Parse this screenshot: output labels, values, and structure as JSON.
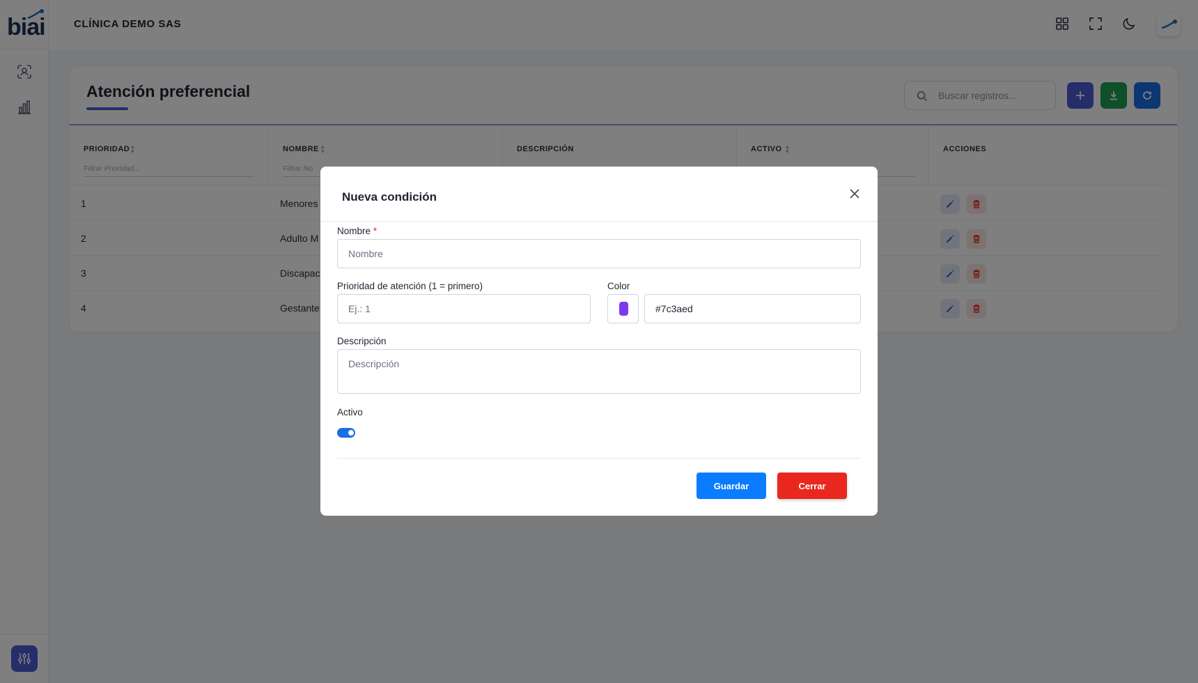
{
  "app": {
    "logo_text": "biai",
    "company_name": "CLÍNICA DEMO SAS"
  },
  "icons": {
    "sidebar": [
      "person-scan-icon",
      "bar-chart-icon",
      "settings-sliders-icon"
    ],
    "header": [
      "grid-icon",
      "fullscreen-icon",
      "moon-icon"
    ]
  },
  "page": {
    "title": "Atención preferencial",
    "search_placeholder": "Buscar registros..."
  },
  "table": {
    "columns": [
      {
        "label": "PRIORIDAD",
        "filter": "Filtrar Prioridad..."
      },
      {
        "label": "NOMBRE",
        "filter": "Filtrar No"
      },
      {
        "label": "DESCRIPCIÓN",
        "filter": ""
      },
      {
        "label": "ACTIVO",
        "filter": ""
      },
      {
        "label": "ACCIONES",
        "filter": ""
      }
    ],
    "rows": [
      {
        "prioridad": "1",
        "nombre": "Menores"
      },
      {
        "prioridad": "2",
        "nombre": "Adulto M"
      },
      {
        "prioridad": "3",
        "nombre": "Discapac"
      },
      {
        "prioridad": "4",
        "nombre": "Gestante"
      }
    ]
  },
  "modal": {
    "title": "Nueva condición",
    "nombre_label": "Nombre",
    "required_mark": "*",
    "nombre_placeholder": "Nombre",
    "prioridad_label": "Prioridad de atención (1 = primero)",
    "prioridad_placeholder": "Ej.: 1",
    "color_label": "Color",
    "color_value": "#7c3aed",
    "descripcion_label": "Descripción",
    "descripcion_placeholder": "Descripción",
    "activo_label": "Activo",
    "activo_on": true,
    "save_label": "Guardar",
    "close_label": "Cerrar"
  },
  "colors": {
    "accent": "#4b5bd6",
    "green": "#1e9e55",
    "blue": "#1a6fe6",
    "swatch": "#7c3aed",
    "save": "#0a7cff",
    "danger": "#e8281e"
  }
}
